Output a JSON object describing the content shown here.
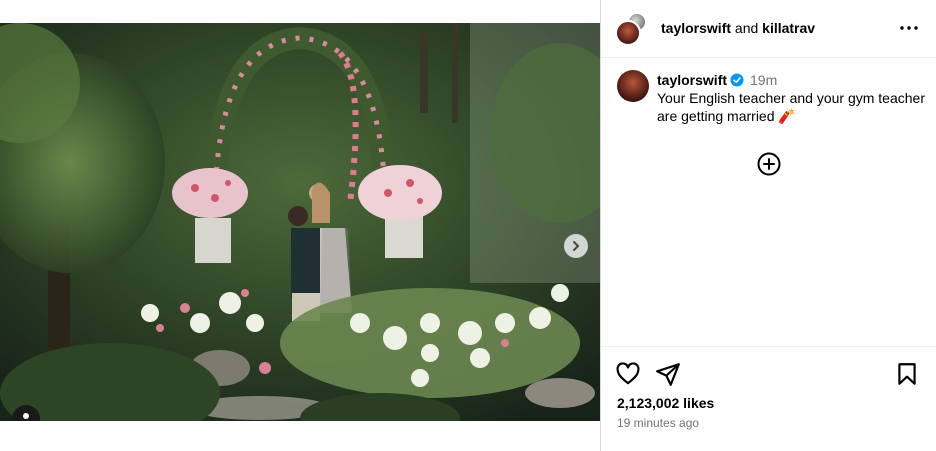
{
  "post": {
    "media_alt": "Garden proposal photo with floral arch",
    "next_icon": "chevron-right-icon",
    "tag_icon": "user-icon"
  },
  "header": {
    "user1": "taylorswift",
    "joiner": "and",
    "user2": "killatrav",
    "more_icon": "more-horizontal-icon"
  },
  "caption": {
    "username": "taylorswift",
    "verified": true,
    "time": "19m",
    "text": "Your English teacher and your gym teacher are getting married 🧨"
  },
  "actions": {
    "like_icon": "heart-icon",
    "share_icon": "send-icon",
    "save_icon": "bookmark-icon",
    "add_comment_icon": "plus-circle-icon"
  },
  "stats": {
    "likes": "2,123,002 likes",
    "posted": "19 minutes ago"
  },
  "colors": {
    "verified": "#0095f6",
    "muted": "#737373",
    "border": "#dbdbdb"
  }
}
